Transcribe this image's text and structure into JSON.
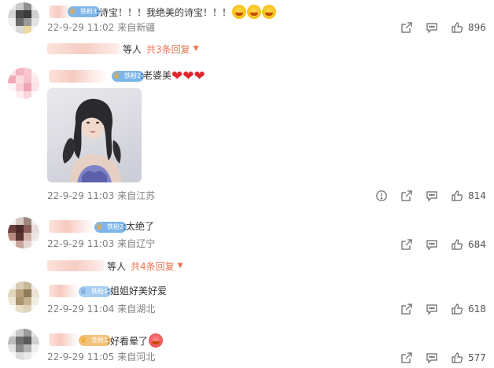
{
  "comments": [
    {
      "badge": "铁粉3",
      "text": ":诗宝！！！我绝美的诗宝！！！",
      "time": "22-9-29 11:02",
      "source": "来自新疆",
      "likes": "896"
    },
    {
      "badge": "铁粉2",
      "text": ":老婆美",
      "time": "22-9-29 11:03",
      "source": "来自江苏",
      "likes": "814"
    },
    {
      "badge": "铁粉2",
      "text": ":太绝了",
      "time": "22-9-29 11:03",
      "source": "来自辽宁",
      "likes": "684"
    },
    {
      "badge": "铁粉1",
      "text": ":姐姐好美好爱",
      "time": "22-9-29 11:04",
      "source": "来自湖北",
      "likes": "618"
    },
    {
      "badge": "金粉1",
      "text": ":好看晕了",
      "time": "22-9-29 11:05",
      "source": "来自河北",
      "likes": "577"
    }
  ],
  "replies": [
    {
      "label": "等人",
      "link": "共3条回复"
    },
    {
      "label": "等人",
      "link": "共4条回复"
    }
  ],
  "colors": {
    "accent": "#eb7350",
    "meta": "#808080",
    "heart": "#e0262b"
  }
}
